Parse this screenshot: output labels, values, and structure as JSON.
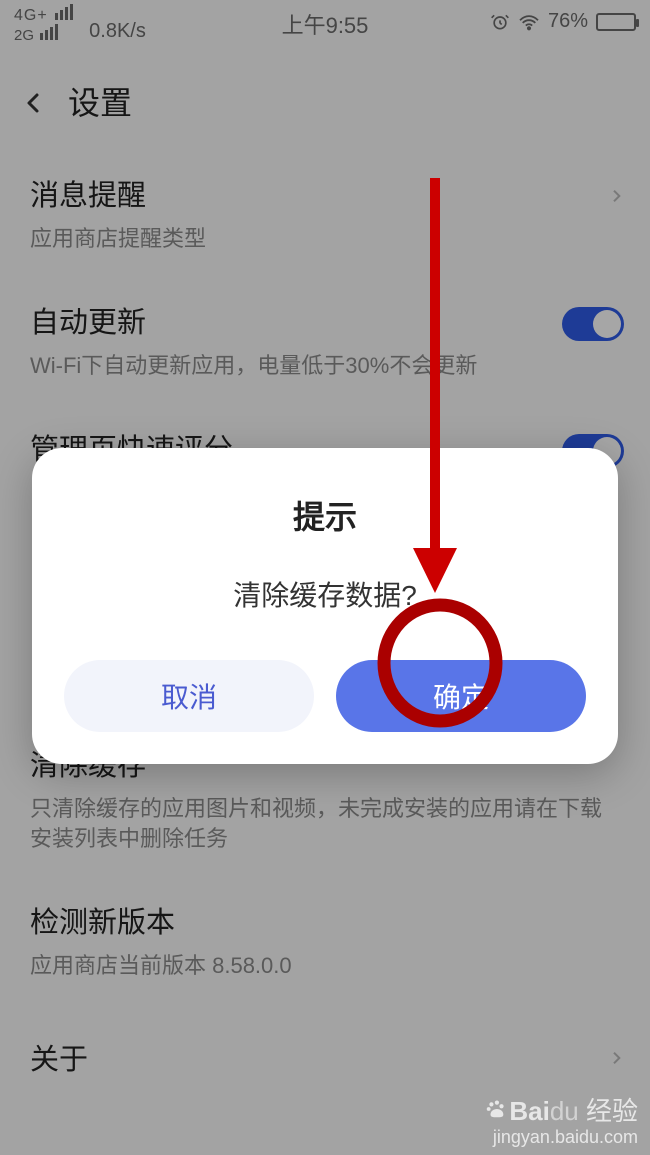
{
  "status": {
    "net_top": "4G+",
    "net_bot": "2G",
    "speed": "0.8K/s",
    "time": "上午9:55",
    "battery_pct": "76%"
  },
  "header": {
    "title": "设置"
  },
  "items": {
    "notify": {
      "title": "消息提醒",
      "sub": "应用商店提醒类型"
    },
    "auto_update": {
      "title": "自动更新",
      "sub": "Wi-Fi下自动更新应用，电量低于30%不会更新"
    },
    "quick_rate": {
      "title": "管理页快速评分"
    },
    "clear_cache": {
      "title": "清除缓存",
      "sub": "只清除缓存的应用图片和视频，未完成安装的应用请在下载安装列表中删除任务"
    },
    "check_update": {
      "title": "检测新版本",
      "sub": "应用商店当前版本 8.58.0.0"
    },
    "about": {
      "title": "关于"
    }
  },
  "dialog": {
    "title": "提示",
    "message": "清除缓存数据?",
    "cancel": "取消",
    "ok": "确定"
  },
  "watermark": {
    "brand_a": "Bai",
    "brand_b": "经验",
    "url": "jingyan.baidu.com"
  }
}
